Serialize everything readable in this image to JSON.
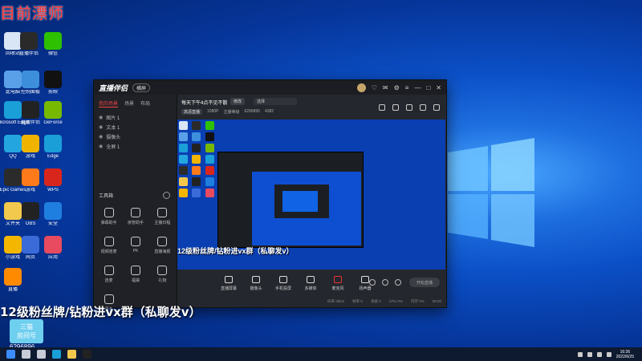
{
  "desktop": {
    "watermark": "目前漂师",
    "banner": "12级粉丝牌/钻粉进vx群（私聊发v）",
    "room_badge_title": "三猫",
    "room_badge_sub": "房间号",
    "room_id": "6296896",
    "icons": [
      {
        "label": "回收站",
        "color": "#d9e6f5"
      },
      {
        "label": "直播伴侣",
        "color": "#2a2a2a"
      },
      {
        "label": "微信",
        "color": "#2dc100"
      },
      {
        "label": "此电脑",
        "color": "#5aa0e8"
      },
      {
        "label": "控制面板",
        "color": "#3d8fdc"
      },
      {
        "label": "剪映",
        "color": "#111111"
      },
      {
        "label": "Microsoft Edge",
        "color": "#1a9fd8"
      },
      {
        "label": "直播伴侣",
        "color": "#222222"
      },
      {
        "label": "GeForce",
        "color": "#76b900"
      },
      {
        "label": "QQ",
        "color": "#23a6e0"
      },
      {
        "label": "游戏",
        "color": "#f0b400"
      },
      {
        "label": "Edge",
        "color": "#1a9fd8"
      },
      {
        "label": "Epic Games",
        "color": "#2b2b2b"
      },
      {
        "label": "游戏",
        "color": "#ff7a1a"
      },
      {
        "label": "WPS",
        "color": "#d9261c"
      },
      {
        "label": "文件夹",
        "color": "#f2c94c"
      },
      {
        "label": "OBS",
        "color": "#222222"
      },
      {
        "label": "安全",
        "color": "#1f7fe0"
      },
      {
        "label": "小游戏",
        "color": "#f5b600"
      },
      {
        "label": "网页",
        "color": "#3a6bd8"
      },
      {
        "label": "应用",
        "color": "#e84a5f"
      },
      {
        "label": "直播",
        "color": "#ff8a00"
      }
    ]
  },
  "app": {
    "name": "直播伴侣",
    "mode": "横屏",
    "side_tabs": [
      "我的场景",
      "场景",
      "布局"
    ],
    "scenes": [
      "图片 1",
      "文本 1",
      "摄像头",
      "全屏 1"
    ],
    "tools_title": "工具箱",
    "tools": [
      "弹幕助手",
      "房管助手",
      "主播日程",
      "视频连麦",
      "PK",
      "直播海报",
      "连麦",
      "福袋",
      "礼物",
      "更多"
    ],
    "stream_title": "每天下午4点不见不散",
    "edit_label": "修改",
    "select_label": "选择",
    "quality": "高清直播",
    "meta": [
      "1080P",
      "主播等级",
      "6296895",
      "4382"
    ],
    "preview_banner": "12级粉丝牌/钻粉进vx群（私聊发v）",
    "controls": [
      "直播屏幕",
      "摄像头",
      "手机投屏",
      "多媒体",
      "麦克风",
      "扬声器"
    ],
    "start_button": "开始直播",
    "status": [
      "码率 0kb/s",
      "帧率 0",
      "丢帧 0",
      "CPU 0%",
      "内存 0%",
      "00:00"
    ]
  },
  "taskbar": {
    "time": "16:36",
    "date": "2022/6/25",
    "apps": [
      {
        "name": "start",
        "color": "#3a8cff"
      },
      {
        "name": "search",
        "color": "#c7ccd6"
      },
      {
        "name": "task-view",
        "color": "#c7ccd6"
      },
      {
        "name": "edge",
        "color": "#1a9fd8"
      },
      {
        "name": "explorer",
        "color": "#f2c94c"
      },
      {
        "name": "live-companion",
        "color": "#222222"
      }
    ]
  }
}
